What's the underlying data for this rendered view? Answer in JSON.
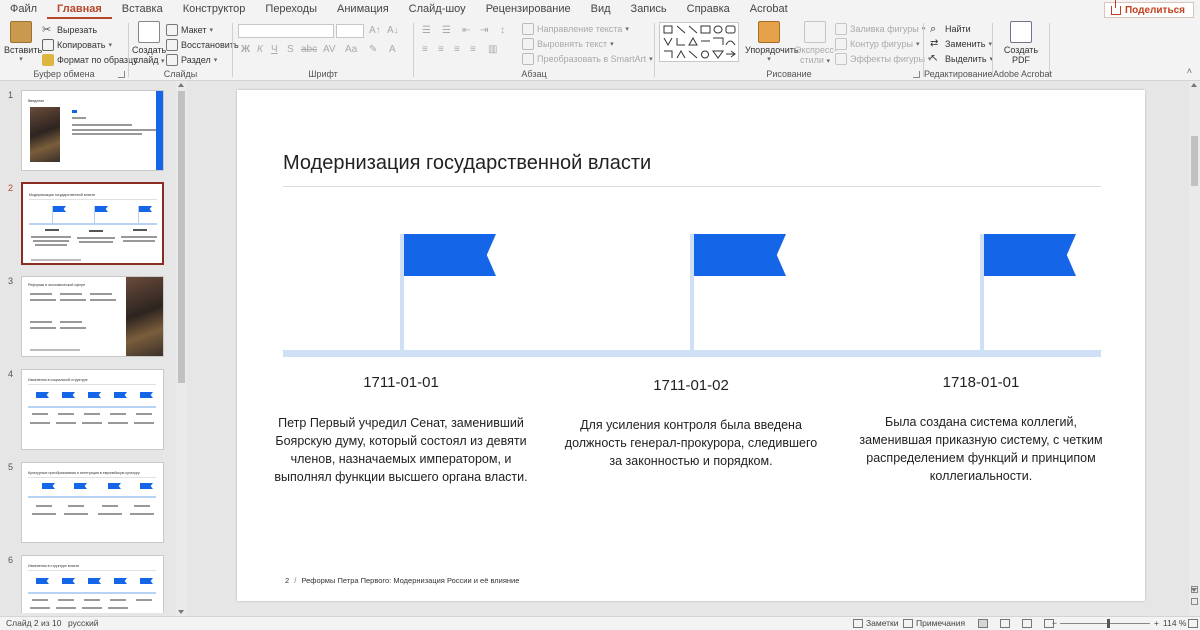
{
  "ribbon_tabs": {
    "file": "Файл",
    "home": "Главная",
    "insert": "Вставка",
    "design": "Конструктор",
    "transitions": "Переходы",
    "animation": "Анимация",
    "slideshow": "Слайд-шоу",
    "review": "Рецензирование",
    "view": "Вид",
    "recording": "Запись",
    "help": "Справка",
    "acrobat": "Acrobat",
    "share": "Поделиться"
  },
  "ribbon": {
    "clipboard": {
      "paste": "Вставить",
      "cut": "Вырезать",
      "copy": "Копировать",
      "format_painter": "Формат по образцу",
      "label": "Буфер обмена"
    },
    "slides": {
      "new_slide_l1": "Создать",
      "new_slide_l2": "слайд",
      "layout": "Макет",
      "reset": "Восстановить",
      "section": "Раздел",
      "label": "Слайды"
    },
    "font": {
      "label": "Шрифт"
    },
    "paragraph": {
      "text_direction": "Направление текста",
      "align_text": "Выровнять текст",
      "smartart": "Преобразовать в SmartArt",
      "label": "Абзац"
    },
    "drawing": {
      "arrange": "Упорядочить",
      "quick_styles_l1": "Экспресс-",
      "quick_styles_l2": "стили",
      "shape_fill": "Заливка фигуры",
      "shape_outline": "Контур фигуры",
      "shape_effects": "Эффекты фигуры",
      "label": "Рисование"
    },
    "editing": {
      "find": "Найти",
      "replace": "Заменить",
      "select": "Выделить",
      "label": "Редактирование"
    },
    "acrobat": {
      "create_pdf_l1": "Создать",
      "create_pdf_l2": "PDF",
      "label": "Adobe Acrobat"
    }
  },
  "thumbnails": {
    "numbers": [
      "1",
      "2",
      "3",
      "4",
      "5",
      "6"
    ],
    "titles": [
      "Введение",
      "Модернизация государственной власти",
      "Реформы в экономической сфере",
      "Изменения в социальной структуре",
      "Культурные преобразования и интеграция в европейскую культуру",
      "Изменения в структуре власти"
    ]
  },
  "slide": {
    "title": "Модернизация государственной власти",
    "events": [
      {
        "date": "1711-01-01",
        "text": "Петр Первый учредил Сенат, заменивший Боярскую думу, который состоял из девяти членов, назначаемых императором, и выполнял функции высшего органа власти."
      },
      {
        "date": "1711-01-02",
        "text": "Для усиления контроля была введена должность генерал-прокурора, следившего за законностью и порядком."
      },
      {
        "date": "1718-01-01",
        "text": "Была создана система коллегий, заменившая приказную систему, с четким распределением функций и принципом коллегиальности."
      }
    ],
    "footer_page": "2",
    "footer_sep": "/",
    "footer_text": "Реформы Петра Первого: Модернизация России и её влияние"
  },
  "statusbar": {
    "slide_of": "Слайд 2 из 10",
    "language": "русский",
    "notes": "Заметки",
    "comments": "Примечания",
    "zoom": "114 %"
  },
  "colors": {
    "accent": "#b7472a",
    "flag": "#1565e8",
    "timeline": "#cfe0f6"
  }
}
